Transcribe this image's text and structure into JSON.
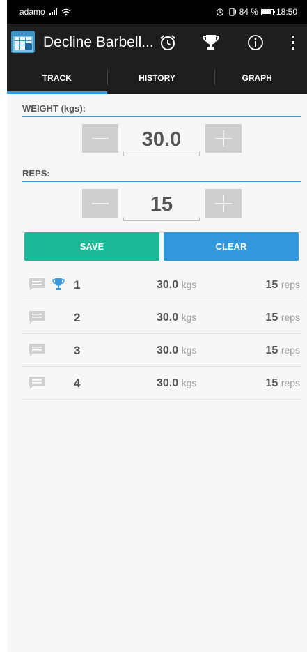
{
  "status_bar": {
    "carrier": "adamo",
    "battery_text": "84 %",
    "time": "18:50",
    "battery_level": 0.84
  },
  "action_bar": {
    "title": "Decline Barbell...",
    "icons": [
      "alarm-clock-icon",
      "trophy-icon",
      "info-icon",
      "overflow-menu-icon"
    ]
  },
  "tabs": [
    {
      "label": "TRACK",
      "active": true
    },
    {
      "label": "HISTORY",
      "active": false
    },
    {
      "label": "GRAPH",
      "active": false
    }
  ],
  "form": {
    "weight_label": "WEIGHT (kgs):",
    "weight_value": "30.0",
    "reps_label": "REPS:",
    "reps_value": "15",
    "save_label": "SAVE",
    "clear_label": "CLEAR"
  },
  "sets": [
    {
      "number": "1",
      "weight": "30.0",
      "weight_unit": "kgs",
      "reps": "15",
      "reps_unit": "reps",
      "record": true
    },
    {
      "number": "2",
      "weight": "30.0",
      "weight_unit": "kgs",
      "reps": "15",
      "reps_unit": "reps",
      "record": false
    },
    {
      "number": "3",
      "weight": "30.0",
      "weight_unit": "kgs",
      "reps": "15",
      "reps_unit": "reps",
      "record": false
    },
    {
      "number": "4",
      "weight": "30.0",
      "weight_unit": "kgs",
      "reps": "15",
      "reps_unit": "reps",
      "record": false
    }
  ],
  "colors": {
    "accent": "#3a9ad9",
    "save": "#1db897",
    "clear": "#3397db",
    "toolbar": "#1e1e1e"
  }
}
